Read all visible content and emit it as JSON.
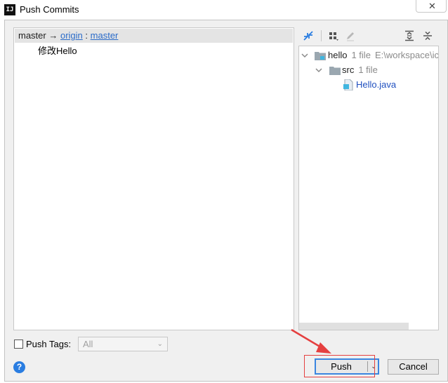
{
  "window": {
    "title": "Push Commits",
    "app_icon_text": "IJ",
    "close_glyph": "✕"
  },
  "commits_panel": {
    "branch": {
      "local": "master",
      "arrow": "→",
      "remote": "origin",
      "separator": ":",
      "remote_branch": "master"
    },
    "commits": [
      {
        "message": "修改Hello"
      }
    ]
  },
  "changes_panel": {
    "toolbar_icons": [
      "expand-icon",
      "group-by-icon",
      "edit-icon",
      "expand-all-icon",
      "collapse-all-icon"
    ],
    "tree": {
      "root": {
        "name": "hello",
        "count": "1 file",
        "path": "E:\\workspace\\ic"
      },
      "folder": {
        "name": "src",
        "count": "1 file"
      },
      "file": {
        "name": "Hello.java"
      }
    }
  },
  "footer": {
    "push_tags_label": "Push Tags:",
    "push_tags_checked": false,
    "tags_select_value": "All",
    "help_glyph": "?",
    "push_label": "Push",
    "cancel_label": "Cancel"
  },
  "colors": {
    "link": "#2a6bc9",
    "accent_border": "#3b86e0",
    "annotation": "#e54040",
    "file_name": "#1f4fbf"
  }
}
